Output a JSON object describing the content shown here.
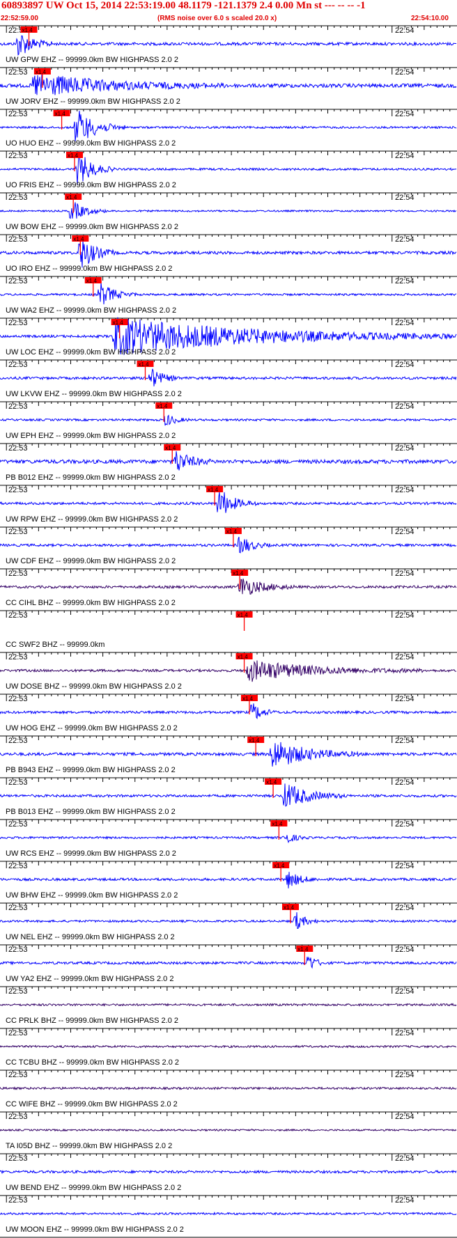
{
  "header": {
    "title": "60893897 UW Oct 15, 2014 22:53:19.00   48.1179 -121.1379  2.4 0.00 Mn st --- -- --   -1",
    "start_time": "22:52:59.00",
    "rms_note": "(RMS noise over 6.0 s scaled 20.0 x)",
    "end_time": "22:54:10.00"
  },
  "chart_data": {
    "type": "line",
    "x_range": [
      "22:52:59.00",
      "22:54:10.00"
    ],
    "minute_labels": [
      "22:53",
      "22:54"
    ],
    "pick_label": "x1.4",
    "colors": {
      "trace": "#0000ff",
      "trace_dark": "#330066",
      "pick": "#ff0000",
      "axis": "#000000"
    },
    "channels": [
      {
        "label": "UW GPW EHZ -- 99999.0km BW  HIGHPASS  2.0  2",
        "pick_s": 4.5,
        "noise": 0.35,
        "burst": 1.2,
        "burst_s": 2.5,
        "dur": 6,
        "color": "blue"
      },
      {
        "label": "UW JORV EHZ -- 99999.0km BW  HIGHPASS  2.0  2",
        "pick_s": 6.6,
        "noise": 0.45,
        "burst": 0.9,
        "burst_s": 5,
        "dur": 30,
        "color": "blue"
      },
      {
        "label": "UO HUO EHZ -- 99999.0km BW  HIGHPASS  2.0  2",
        "pick_s": 9.6,
        "noise": 0.25,
        "burst": 1.6,
        "burst_s": 11.5,
        "dur": 8,
        "color": "blue"
      },
      {
        "label": "UO FRIS EHZ -- 99999.0km BW  HIGHPASS  2.0  2",
        "pick_s": 11.6,
        "noise": 0.25,
        "burst": 1.6,
        "burst_s": 11.8,
        "dur": 6,
        "color": "blue"
      },
      {
        "label": "UW BOW EHZ -- 99999.0km BW  HIGHPASS  2.0  2",
        "pick_s": 11.4,
        "noise": 0.2,
        "burst": 0.9,
        "burst_s": 10.8,
        "dur": 6,
        "color": "blue"
      },
      {
        "label": "UO IRO EHZ -- 99999.0km BW  HIGHPASS  2.0  2",
        "pick_s": 12.5,
        "noise": 0.35,
        "burst": 1.5,
        "burst_s": 12.2,
        "dur": 6,
        "color": "blue"
      },
      {
        "label": "UW WA2 EHZ -- 99999.0km BW  HIGHPASS  2.0  2",
        "pick_s": 14.5,
        "noise": 0.25,
        "burst": 1.1,
        "burst_s": 15.2,
        "dur": 6,
        "color": "blue"
      },
      {
        "label": "UW LOC EHZ -- 99999.0km BW  HIGHPASS  2.0  2",
        "pick_s": 18.6,
        "noise": 0.3,
        "burst": 1.4,
        "burst_s": 17.5,
        "dur": 60,
        "color": "blue"
      },
      {
        "label": "UW LKVW EHZ -- 99999.0km BW  HIGHPASS  2.0  2",
        "pick_s": 22.6,
        "noise": 0.3,
        "burst": 1.0,
        "burst_s": 23.0,
        "dur": 5,
        "color": "blue"
      },
      {
        "label": "UW EPH EHZ -- 99999.0km BW  HIGHPASS  2.0  2",
        "pick_s": 25.5,
        "noise": 0.25,
        "burst": 0.6,
        "burst_s": 25.5,
        "dur": 4,
        "color": "blue"
      },
      {
        "label": "PB B012 EHZ -- 99999.0km BW  HIGHPASS  2.0  2",
        "pick_s": 26.8,
        "noise": 0.45,
        "burst": 1.0,
        "burst_s": 27.0,
        "dur": 6,
        "color": "blue"
      },
      {
        "label": "UW RPW EHZ -- 99999.0km BW  HIGHPASS  2.0  2",
        "pick_s": 33.4,
        "noise": 0.3,
        "burst": 1.3,
        "burst_s": 33.8,
        "dur": 6,
        "color": "blue"
      },
      {
        "label": "UW CDF EHZ -- 99999.0km BW  HIGHPASS  2.0  2",
        "pick_s": 36.3,
        "noise": 0.3,
        "burst": 0.9,
        "burst_s": 37.0,
        "dur": 5,
        "color": "blue"
      },
      {
        "label": "CC CIHL BHZ -- 99999.0km BW  HIGHPASS  2.0  2",
        "pick_s": 37.3,
        "noise": 0.3,
        "burst": 0.9,
        "burst_s": 37.0,
        "dur": 9,
        "color": "dark"
      },
      {
        "label": "CC SWF2 BHZ -- 99999.0km",
        "pick_s": 38.0,
        "noise": 0.0,
        "burst": 0.0,
        "burst_s": 0,
        "dur": 0,
        "color": "dark"
      },
      {
        "label": "UW DOSE BHZ -- 99999.0km BW  HIGHPASS  2.0  2",
        "pick_s": 38.0,
        "noise": 0.3,
        "burst": 0.8,
        "burst_s": 38.2,
        "dur": 28,
        "color": "dark"
      },
      {
        "label": "UW HOG EHZ -- 99999.0km BW  HIGHPASS  2.0  2",
        "pick_s": 38.8,
        "noise": 0.3,
        "burst": 0.9,
        "burst_s": 39.0,
        "dur": 4,
        "color": "blue"
      },
      {
        "label": "PB B943 EHZ -- 99999.0km BW  HIGHPASS  2.0  2",
        "pick_s": 39.8,
        "noise": 0.35,
        "burst": 1.2,
        "burst_s": 42.0,
        "dur": 14,
        "color": "blue"
      },
      {
        "label": "PB B013 EHZ -- 99999.0km BW  HIGHPASS  2.0  2",
        "pick_s": 42.5,
        "noise": 0.3,
        "burst": 1.1,
        "burst_s": 44.0,
        "dur": 10,
        "color": "blue"
      },
      {
        "label": "UW RCS EHZ -- 99999.0km BW  HIGHPASS  2.0  2",
        "pick_s": 43.4,
        "noise": 0.25,
        "burst": 0.6,
        "burst_s": 44.0,
        "dur": 4,
        "color": "blue"
      },
      {
        "label": "UW BHW EHZ -- 99999.0km BW  HIGHPASS  2.0  2",
        "pick_s": 43.7,
        "noise": 0.3,
        "burst": 0.8,
        "burst_s": 44.5,
        "dur": 5,
        "color": "blue"
      },
      {
        "label": "UW NEL EHZ -- 99999.0km BW  HIGHPASS  2.0  2",
        "pick_s": 45.2,
        "noise": 0.25,
        "burst": 0.9,
        "burst_s": 45.6,
        "dur": 4,
        "color": "blue"
      },
      {
        "label": "UW YA2 EHZ -- 99999.0km BW  HIGHPASS  2.0  2",
        "pick_s": 47.4,
        "noise": 0.3,
        "burst": 1.0,
        "burst_s": 47.6,
        "dur": 3,
        "color": "blue"
      },
      {
        "label": "CC PRLK BHZ -- 99999.0km BW  HIGHPASS  2.0  2",
        "pick_s": null,
        "noise": 0.25,
        "burst": 0,
        "burst_s": 0,
        "dur": 0,
        "color": "dark"
      },
      {
        "label": "CC TCBU BHZ -- 99999.0km BW  HIGHPASS  2.0  2",
        "pick_s": null,
        "noise": 0.25,
        "burst": 0,
        "burst_s": 0,
        "dur": 0,
        "color": "dark"
      },
      {
        "label": "CC WIFE BHZ -- 99999.0km BW  HIGHPASS  2.0  2",
        "pick_s": null,
        "noise": 0.25,
        "burst": 0,
        "burst_s": 0,
        "dur": 0,
        "color": "dark"
      },
      {
        "label": "TA I05D BHZ -- 99999.0km BW  HIGHPASS  2.0  2",
        "pick_s": null,
        "noise": 0.2,
        "burst": 0,
        "burst_s": 0,
        "dur": 0,
        "color": "dark"
      },
      {
        "label": "UW BEND EHZ -- 99999.0km BW  HIGHPASS  2.0  2",
        "pick_s": null,
        "noise": 0.3,
        "burst": 0,
        "burst_s": 0,
        "dur": 0,
        "color": "blue"
      },
      {
        "label": "UW MOON EHZ -- 99999.0km BW  HIGHPASS  2.0  2",
        "pick_s": null,
        "noise": 0.25,
        "burst": 0,
        "burst_s": 0,
        "dur": 0,
        "color": "blue"
      }
    ]
  }
}
